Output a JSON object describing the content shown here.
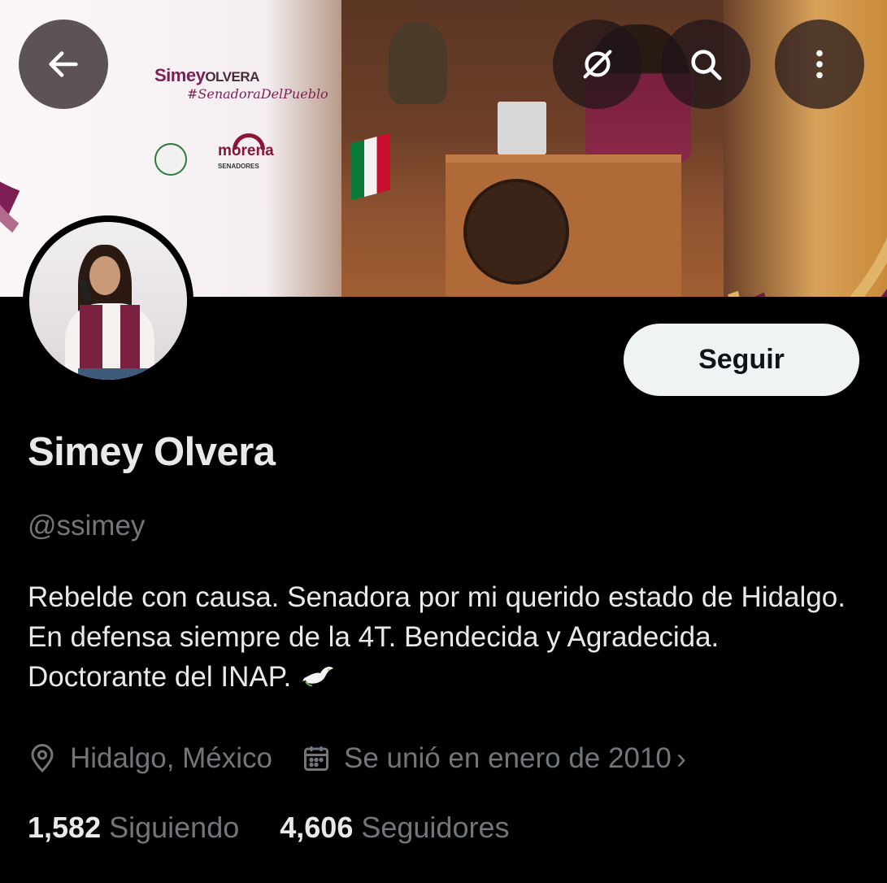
{
  "banner": {
    "logo_first": "Simey",
    "logo_last": "OLVERA",
    "hashtag": "#SenadoraDelPueblo",
    "party": "morena",
    "party_sub": "SENADORES"
  },
  "toolbar": {
    "back_icon": "arrow-left-icon",
    "dm_icon": "spaces-icon",
    "search_icon": "search-icon",
    "more_icon": "more-vertical-icon"
  },
  "profile": {
    "follow_label": "Seguir",
    "name": "Simey Olvera",
    "handle": "@ssimey",
    "bio": "Rebelde con causa. Senadora por mi querido estado de Hidalgo. En defensa siempre de la 4T. Bendecida y Agradecida. Doctorante del INAP.",
    "location": "Hidalgo, México",
    "joined": "Se unió en enero de 2010",
    "following_count": "1,582",
    "following_label": "Siguiendo",
    "followers_count": "4,606",
    "followers_label": "Seguidores"
  },
  "colors": {
    "background": "#000000",
    "text_primary": "#e7e9ea",
    "text_secondary": "#71767b",
    "brand_accent": "#7d1f55"
  }
}
